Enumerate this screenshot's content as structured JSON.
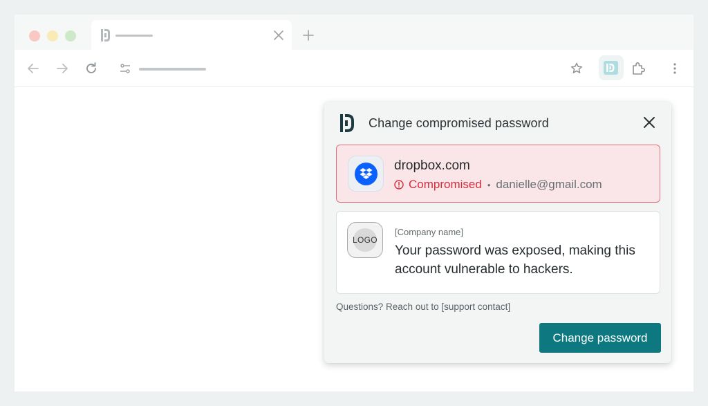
{
  "browser": {
    "tab": {
      "title": ""
    },
    "toolbar": {
      "url": ""
    }
  },
  "popup": {
    "title": "Change compromised password",
    "credential": {
      "site": "dropbox.com",
      "status": "Compromised",
      "separator": "•",
      "email": "danielle@gmail.com",
      "icon": "dropbox-icon"
    },
    "info": {
      "logo_label": "LOGO",
      "company": "[Company name]",
      "message": "Your password was exposed, making this account vulnerable to hackers."
    },
    "help": "Questions? Reach out to [support contact]",
    "action_label": "Change password"
  },
  "colors": {
    "accent": "#0d7880",
    "danger": "#d12d3d",
    "danger_bg": "#fae6e8",
    "dropbox_blue": "#0b61fe"
  }
}
